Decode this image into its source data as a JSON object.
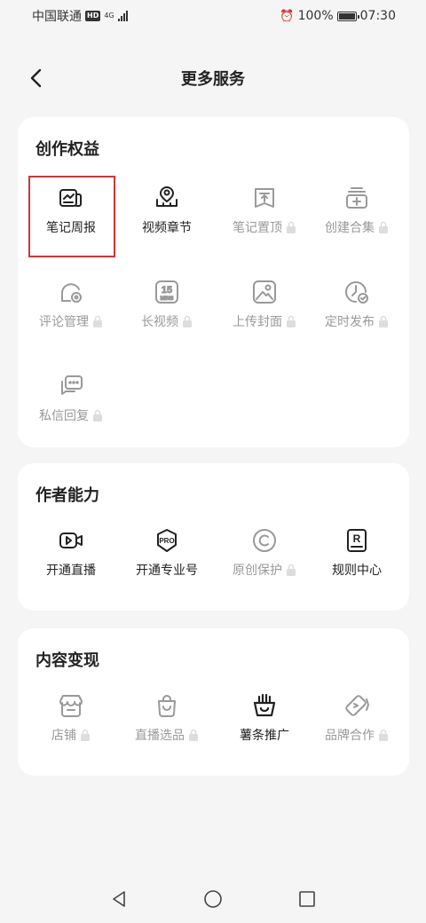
{
  "status_bar": {
    "carrier": "中国联通",
    "hd": "HD",
    "network": "4G",
    "battery": "100%",
    "time": "07:30"
  },
  "header": {
    "title": "更多服务"
  },
  "sections": [
    {
      "title": "创作权益",
      "items": [
        {
          "label": "笔记周报",
          "icon": "chart-document-icon",
          "locked": false,
          "highlighted": true
        },
        {
          "label": "视频章节",
          "icon": "location-pin-icon",
          "locked": false
        },
        {
          "label": "笔记置顶",
          "icon": "pin-top-icon",
          "locked": true
        },
        {
          "label": "创建合集",
          "icon": "collection-add-icon",
          "locked": true
        },
        {
          "label": "评论管理",
          "icon": "comment-settings-icon",
          "locked": true
        },
        {
          "label": "长视频",
          "icon": "15-mins-icon",
          "icon_text": [
            "15",
            "MINS"
          ],
          "locked": true
        },
        {
          "label": "上传封面",
          "icon": "image-cover-icon",
          "locked": true
        },
        {
          "label": "定时发布",
          "icon": "schedule-clock-icon",
          "locked": true
        },
        {
          "label": "私信回复",
          "icon": "message-reply-icon",
          "locked": true
        }
      ]
    },
    {
      "title": "作者能力",
      "items": [
        {
          "label": "开通直播",
          "icon": "live-camera-icon",
          "locked": false
        },
        {
          "label": "开通专业号",
          "icon": "pro-badge-icon",
          "icon_text": "PRO",
          "locked": false
        },
        {
          "label": "原创保护",
          "icon": "copyright-icon",
          "locked": true
        },
        {
          "label": "规则中心",
          "icon": "rules-book-icon",
          "icon_text": "R",
          "locked": false
        }
      ]
    },
    {
      "title": "内容变现",
      "items": [
        {
          "label": "店铺",
          "icon": "store-icon",
          "locked": true
        },
        {
          "label": "直播选品",
          "icon": "shopping-bag-icon",
          "locked": true
        },
        {
          "label": "薯条推广",
          "icon": "fries-icon",
          "locked": false
        },
        {
          "label": "品牌合作",
          "icon": "brand-tag-icon",
          "locked": true
        }
      ]
    }
  ],
  "colors": {
    "background": "#f5f5f5",
    "card": "#ffffff",
    "text": "#222222",
    "locked_text": "#999999",
    "highlight": "#c8383b"
  }
}
